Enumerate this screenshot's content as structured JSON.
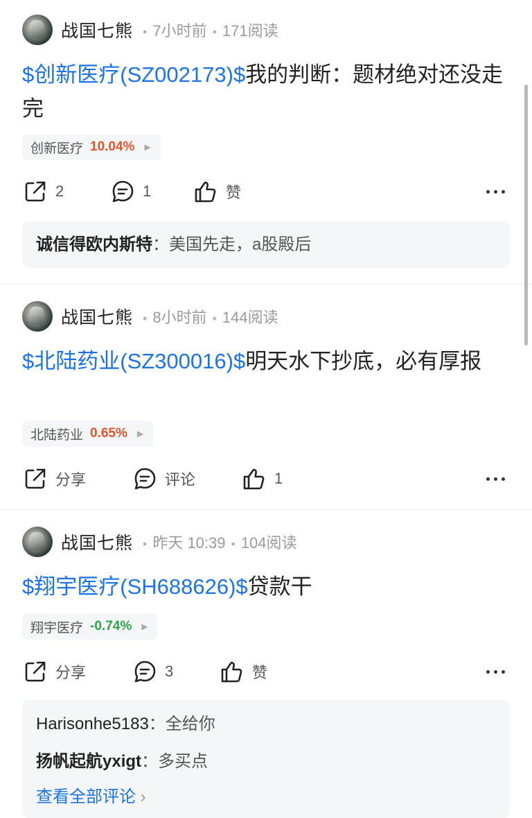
{
  "posts": [
    {
      "author": "战国七熊",
      "time": "7小时前",
      "reads": "171阅读",
      "stock_link": "$创新医疗(SZ002173)$",
      "text": "我的判断：题材绝对还没走完",
      "tag": {
        "name": "创新医疗",
        "pct": "10.04%",
        "color": "#e5532d"
      },
      "actions": {
        "share": "2",
        "comment": "1",
        "like": "赞"
      },
      "comments": [
        {
          "name": "诚信得欧内斯特",
          "sep": "：",
          "text": "美国先走，a股殿后"
        }
      ]
    },
    {
      "author": "战国七熊",
      "time": "8小时前",
      "reads": "144阅读",
      "stock_link": "$北陆药业(SZ300016)$",
      "text": "明天水下抄底，必有厚报",
      "tag": {
        "name": "北陆药业",
        "pct": "0.65%",
        "color": "#e5532d"
      },
      "actions": {
        "share": "分享",
        "comment": "评论",
        "like": "1"
      }
    },
    {
      "author": "战国七熊",
      "time": "昨天 10:39",
      "reads": "104阅读",
      "stock_link": "$翔宇医疗(SH688626)$",
      "text": "贷款干",
      "tag": {
        "name": "翔宇医疗",
        "pct": "-0.74%",
        "color": "#2fa54a"
      },
      "actions": {
        "share": "分享",
        "comment": "3",
        "like": "赞"
      },
      "comments": [
        {
          "name": "Harisonhe5183",
          "sep": "：",
          "text": "全给你"
        },
        {
          "name": "扬帆起航yxigt",
          "sep": "：",
          "text": "多买点"
        }
      ],
      "view_all": "查看全部评论",
      "view_all_arrow": "›"
    }
  ],
  "icons": {
    "share": "share-icon",
    "comment": "comment-icon",
    "like": "thumbs-up-icon",
    "more": "more-icon"
  },
  "colors": {
    "link": "#1a73e8",
    "up": "#e5532d",
    "down": "#2fa54a"
  }
}
